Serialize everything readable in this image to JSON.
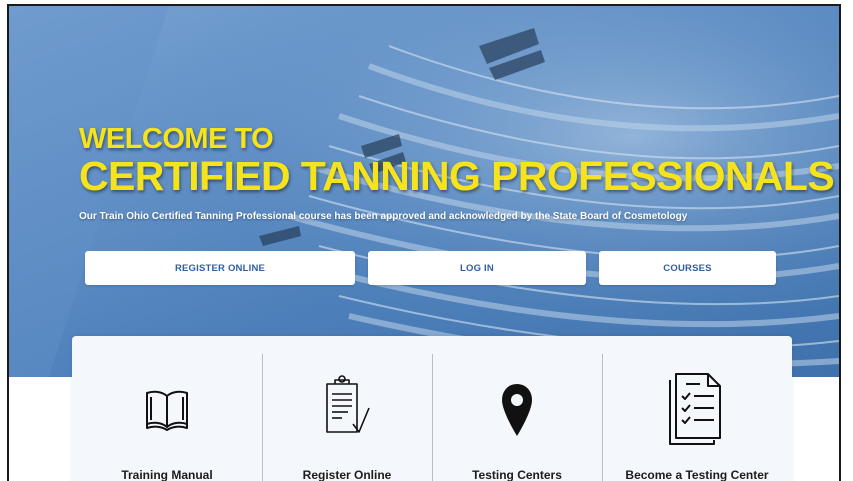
{
  "hero": {
    "welcome": "WELCOME TO",
    "headline": "CERTIFIED TANNING PROFESSIONALS",
    "subline": "Our Train Ohio Certified Tanning Professional course has been approved and acknowledged by the State Board of Cosmetology"
  },
  "buttons": {
    "register": "REGISTER ONLINE",
    "login": "LOG IN",
    "courses": "COURSES"
  },
  "features": [
    {
      "label": "Training Manual",
      "icon": "open-book-icon"
    },
    {
      "label": "Register Online",
      "icon": "clipboard-check-icon"
    },
    {
      "label": "Testing Centers",
      "icon": "map-pin-icon"
    },
    {
      "label": "Become a Testing Center",
      "icon": "checklist-document-icon"
    }
  ],
  "colors": {
    "headline": "#f5e31c",
    "button_text": "#2f5ea3",
    "hero_bg": "#4a7db9",
    "panel_bg": "#f4f7fb"
  }
}
